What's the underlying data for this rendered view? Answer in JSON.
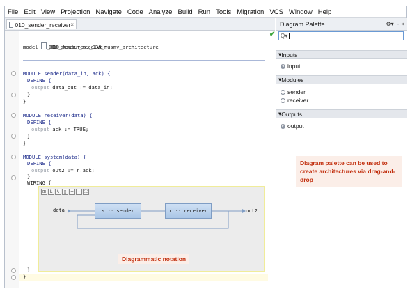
{
  "menu": [
    "File",
    "Edit",
    "View",
    "Projection",
    "Navigate",
    "Code",
    "Analyze",
    "Build",
    "Run",
    "Tools",
    "Migration",
    "VCS",
    "Window",
    "Help"
  ],
  "menu_mnemonic": [
    "F",
    "E",
    "V",
    "",
    "N",
    "C",
    "",
    "B",
    "u",
    "T",
    "M",
    "S",
    "W",
    "H"
  ],
  "tab": {
    "label": "010_sender_receiver",
    "close": "×"
  },
  "editor": {
    "model_name": "010_sender_receiver",
    "model_kw": "model",
    "model_path": "_010_features._030_nusmv_architecture",
    "lines": {
      "l1": "MODULE sender(data_in, ack) {",
      "l2": "DEFINE {",
      "l3a": "output",
      "l3b": " data_out := data_in;",
      "l4": "}",
      "l5": "}",
      "l6": "MODULE receiver(data) {",
      "l7": "DEFINE {",
      "l8a": "output",
      "l8b": " ack := TRUE;",
      "l9": "}",
      "l10": "}",
      "l11": "MODULE system(data) {",
      "l12": "DEFINE {",
      "l13a": "output",
      "l13b": " out2 := r.ack;",
      "l14": "}",
      "l15": "WIRING {",
      "l16": "}",
      "l17": "}"
    },
    "valid_mark": "✔"
  },
  "diagram": {
    "tools": [
      "⊞",
      "L",
      "↳",
      "▯",
      "+",
      "−",
      "⛶"
    ],
    "input_label": "data",
    "output_label": "out2",
    "sender_block": "s :: sender",
    "receiver_block": "r :: receiver"
  },
  "annotations": {
    "diagram_note": "Diagrammatic notation",
    "palette_note": "Diagram palette can be used to create architectures via drag-and-drop"
  },
  "palette": {
    "title": "Diagram Palette",
    "header_icons": [
      "⚙▾",
      "-⇥"
    ],
    "search_icon": "Q▾",
    "sections": [
      {
        "label": "Inputs",
        "items": [
          "input"
        ]
      },
      {
        "label": "Modules",
        "items": [
          "sender",
          "receiver"
        ]
      },
      {
        "label": "Outputs",
        "items": [
          "output"
        ]
      }
    ]
  },
  "colors": {
    "accent": "#6a9ad4",
    "note_text": "#c22f0e",
    "block": "#aac6e6"
  }
}
